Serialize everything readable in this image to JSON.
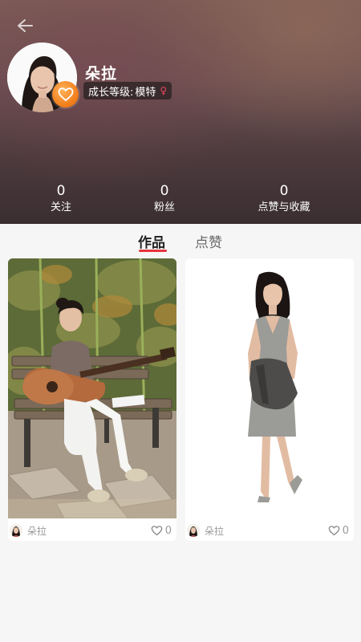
{
  "profile": {
    "name": "朵拉",
    "level_label": "成长等级:",
    "level_value": "模特",
    "gender_symbol": "♀"
  },
  "stats": [
    {
      "count": "0",
      "label": "关注"
    },
    {
      "count": "0",
      "label": "粉丝"
    },
    {
      "count": "0",
      "label": "点赞与收藏"
    }
  ],
  "tabs": [
    {
      "label": "作品",
      "active": true
    },
    {
      "label": "点赞",
      "active": false
    }
  ],
  "works": [
    {
      "author": "朵拉",
      "likes": "0"
    },
    {
      "author": "朵拉",
      "likes": "0"
    }
  ],
  "icons": {
    "back": "arrow-left-icon",
    "badge": "heart-badge-icon",
    "like": "heart-outline-icon"
  },
  "colors": {
    "accent_red": "#e8343c",
    "badge_orange": "#f07a16",
    "gender_pink": "#e8485a"
  }
}
